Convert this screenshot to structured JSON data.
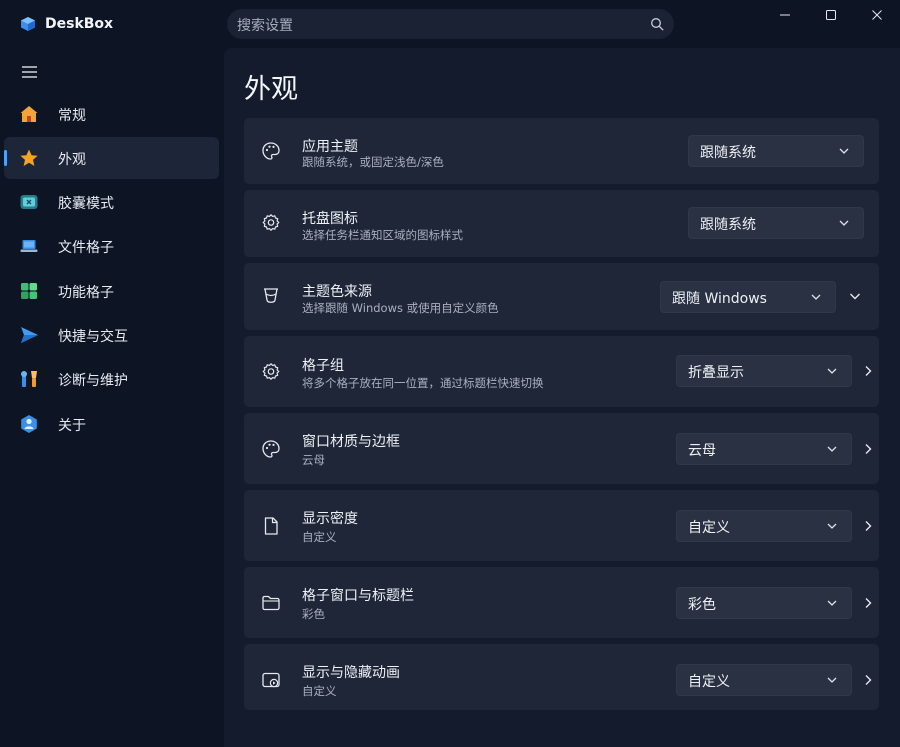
{
  "app": {
    "name": "DeskBox"
  },
  "search": {
    "placeholder": "搜索设置"
  },
  "sidebar": {
    "items": [
      {
        "label": "常规",
        "icon": "home-icon"
      },
      {
        "label": "外观",
        "icon": "star-icon",
        "active": true
      },
      {
        "label": "胶囊模式",
        "icon": "capsule-icon"
      },
      {
        "label": "文件格子",
        "icon": "laptop-icon"
      },
      {
        "label": "功能格子",
        "icon": "grid-icon"
      },
      {
        "label": "快捷与交互",
        "icon": "send-icon"
      },
      {
        "label": "诊断与维护",
        "icon": "tools-icon"
      },
      {
        "label": "关于",
        "icon": "info-icon"
      }
    ]
  },
  "page": {
    "title": "外观"
  },
  "settings": [
    {
      "title": "应用主题",
      "subtitle": "跟随系统，或固定浅色/深色",
      "value": "跟随系统",
      "icon": "palette-icon",
      "action": "none"
    },
    {
      "title": "托盘图标",
      "subtitle": "选择任务栏通知区域的图标样式",
      "value": "跟随系统",
      "icon": "gear-icon",
      "action": "none"
    },
    {
      "title": "主题色来源",
      "subtitle": "选择跟随 Windows 或使用自定义颜色",
      "value": "跟随 Windows",
      "icon": "paint-bucket-icon",
      "action": "expand"
    },
    {
      "title": "格子组",
      "subtitle": "将多个格子放在同一位置，通过标题栏快速切换",
      "value": "折叠显示",
      "icon": "gear-icon",
      "action": "navigate"
    },
    {
      "title": "窗口材质与边框",
      "subtitle": "云母",
      "value": "云母",
      "icon": "palette-icon",
      "action": "navigate"
    },
    {
      "title": "显示密度",
      "subtitle": "自定义",
      "value": "自定义",
      "icon": "document-icon",
      "action": "navigate"
    },
    {
      "title": "格子窗口与标题栏",
      "subtitle": "彩色",
      "value": "彩色",
      "icon": "folder-icon",
      "action": "navigate"
    },
    {
      "title": "显示与隐藏动画",
      "subtitle": "自定义",
      "value": "自定义",
      "icon": "window-play-icon",
      "action": "navigate"
    }
  ],
  "colors": {
    "accent": "#4ba3f8",
    "background": "#0d1424",
    "card": "#1f2638"
  }
}
